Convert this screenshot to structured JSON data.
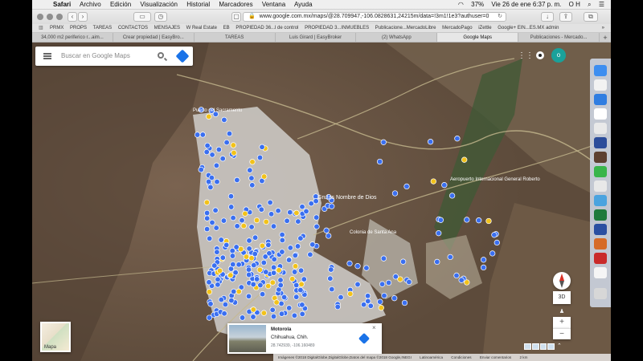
{
  "menubar": {
    "app": "Safari",
    "menus": [
      "Archivo",
      "Edición",
      "Visualización",
      "Historial",
      "Marcadores",
      "Ventana",
      "Ayuda"
    ],
    "battery": "37%",
    "clock": "Vie 26 de ene  6:37 p. m.",
    "user": "O H"
  },
  "toolbar": {
    "url": "www.google.com.mx/maps/@28.709947,-106.0828631,24215m/data=!3m1!1e3?authuser=0"
  },
  "bookmarks": [
    "PRMX",
    "PROPS",
    "TAREAS",
    "CONTACTOS",
    "MENSAJES",
    "W Real Estate",
    "EB",
    "PROPIEDAD 36...l de control",
    "PROPIEDAD 3...INMUEBLES",
    "Publicacione...MercadoLibre",
    "MercadoPago",
    "iZettle",
    "Google+ EIN...ES.MX admin"
  ],
  "tabs": [
    {
      "label": "34,000 m2 periferico r...aim...",
      "active": false
    },
    {
      "label": "Crear propiedad | EasyBro...",
      "active": false
    },
    {
      "label": "TAREAS",
      "active": false
    },
    {
      "label": "Luis Girard | EasyBroker",
      "active": false
    },
    {
      "label": "(2) WhatsApp",
      "active": false
    },
    {
      "label": "Google Maps",
      "active": true
    },
    {
      "label": "Publicaciones - Mercado...",
      "active": false
    }
  ],
  "map": {
    "search_placeholder": "Buscar en Google Maps",
    "avatar_initial": "o",
    "layer_label": "Mapa",
    "labels": {
      "sacramento": "Puerto del Sacramento",
      "grutas": "Grutas Nombre de Dios",
      "aeropuerto": "Aeropuerto Internacional General Roberto",
      "santa_ana": "Colonia de Santa Ana"
    },
    "info_card": {
      "title": "Motorola",
      "address": "Chihuahua, Chih.",
      "coords": "28.742939, -106.160489"
    },
    "controls": {
      "tilt_label": "3D",
      "zoom_in": "+",
      "zoom_out": "−"
    },
    "footer": [
      "Imágenes ©2018 DigitalGlobe,DigitalGlobe,Datos del mapa ©2018 Google,INEGI",
      "Latinoamérica",
      "Condiciones",
      "Enviar comentarios",
      "2 km"
    ]
  },
  "colors": {
    "pin_blue": "#3a6ff0",
    "pin_yellow": "#f2c21a",
    "urban": "#c9c6c1",
    "terrain": "#6e5a48",
    "accent": "#1a73e8"
  }
}
